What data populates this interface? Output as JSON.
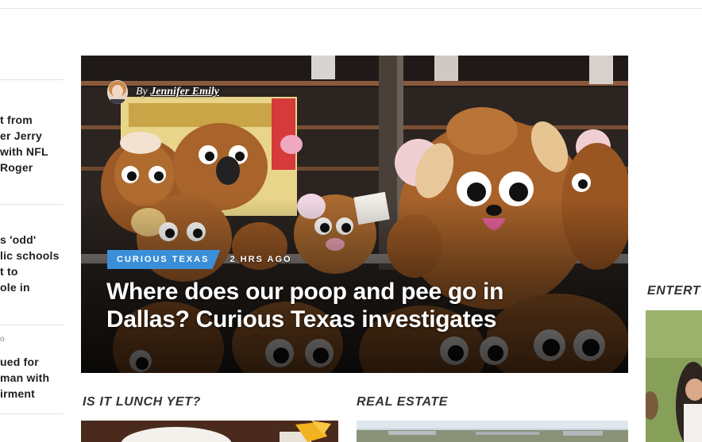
{
  "left_stories": [
    {
      "meta": "",
      "lines": [
        "t from",
        "er Jerry",
        " with NFL",
        "Roger"
      ]
    },
    {
      "meta": "",
      "lines": [
        "s 'odd'",
        "lic schools",
        "t to",
        "ole in"
      ]
    },
    {
      "meta": "o",
      "lines": [
        "ued for",
        "man with",
        "irment"
      ]
    }
  ],
  "hero": {
    "byline_prefix": "By",
    "author": "Jennifer Emily",
    "tag": "CURIOUS TEXAS",
    "time": "2 HRS AGO",
    "headline_line1": "Where does our poop and pee go in",
    "headline_line2": "Dallas? Curious Texas investigates"
  },
  "sections": {
    "lunch": "IS IT LUNCH YET?",
    "real_estate": "REAL ESTATE",
    "entertainment": "ENTERT"
  },
  "colors": {
    "tag_blue": "#3a8fd8",
    "kicker_text": "#333333"
  }
}
